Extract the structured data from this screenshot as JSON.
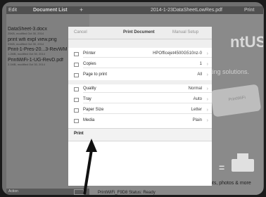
{
  "statusbar": {
    "edit": "Edit",
    "doc_list": "Document List",
    "plus": "+",
    "filename": "2014-1-23DataSheetLowRes.pdf",
    "print": "Print"
  },
  "documents": [
    {
      "name": "DataSheet-3.docx",
      "meta": "25KB, modified Oct 30, 2014"
    },
    {
      "name": "print wifi expl view.png",
      "meta": "93KB, modified Oct 30, 2014"
    },
    {
      "name": "Print-1-Pres-20...3-RevWM",
      "meta": "1.2MB, modified Oct 30, 2014"
    },
    {
      "name": "PrintWiFi-1-UG-RevD.pdf",
      "meta": "3.1MB, modified Oct 30, 2014"
    }
  ],
  "left_footer": {
    "label": "Action"
  },
  "background": {
    "logo_text": "ntUSB",
    "logo_mark": "®",
    "tagline": "ting solutions.",
    "device_logo": "PrintWiFi",
    "equals": "=",
    "bottom_text": "Print attachments, web pages, documents, photos & more",
    "wifi_status": "PrintWiFi_F9D8 Status: Ready"
  },
  "dialog": {
    "cancel": "Cancel",
    "title": "Print Document",
    "manual_setup": "Manual Setup",
    "rows": [
      {
        "label": "Printer",
        "value": "HPOfficejet4500G510nz-0",
        "icon": "printer-icon"
      },
      {
        "label": "Copies",
        "value": "1",
        "icon": "copies-icon"
      },
      {
        "label": "Page to print",
        "value": "All",
        "icon": "page-icon"
      },
      {
        "label": "Quality",
        "value": "Normal",
        "icon": "quality-icon"
      },
      {
        "label": "Tray",
        "value": "Auto",
        "icon": "tray-icon"
      },
      {
        "label": "Paper Size",
        "value": "Letter",
        "icon": "paper-icon"
      },
      {
        "label": "Media",
        "value": "Plain",
        "icon": "media-icon"
      }
    ],
    "chevron": "›",
    "print_label": "Print"
  }
}
